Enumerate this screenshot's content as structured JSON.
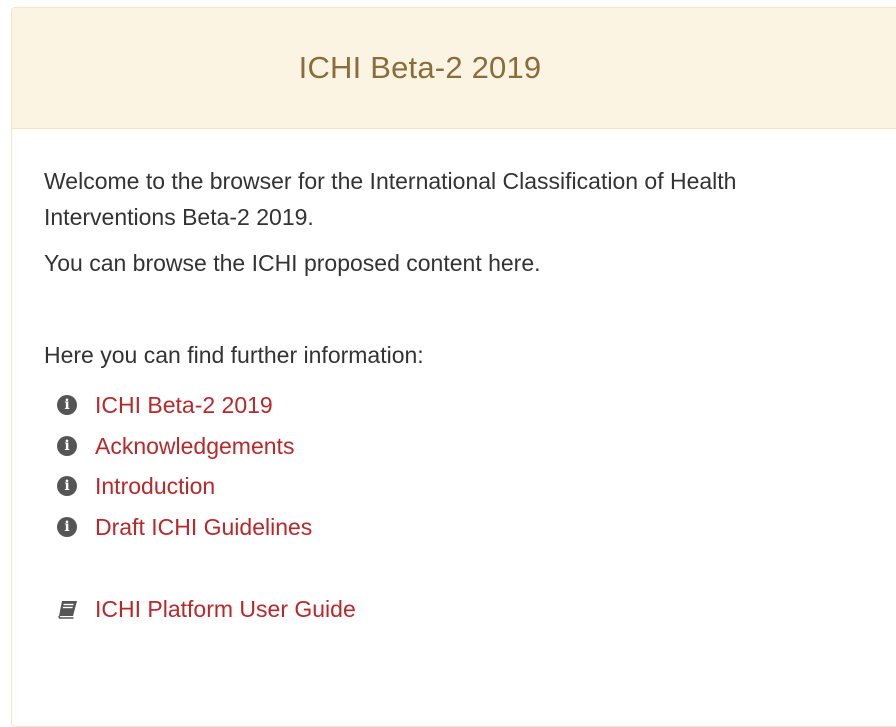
{
  "header": {
    "title": "ICHI Beta-2 2019"
  },
  "intro": {
    "welcome": "Welcome to the browser for the International Classification of Health Interventions Beta-2 2019.",
    "browse": "You can browse the ICHI proposed content here.",
    "further": "Here you can find further information:"
  },
  "links": [
    {
      "label": "ICHI Beta-2 2019",
      "icon": "info-icon"
    },
    {
      "label": "Acknowledgements",
      "icon": "info-icon"
    },
    {
      "label": "Introduction",
      "icon": "info-icon"
    },
    {
      "label": "Draft ICHI Guidelines",
      "icon": "info-icon"
    }
  ],
  "guide": {
    "label": "ICHI Platform User Guide",
    "icon": "book-icon"
  },
  "colors": {
    "header_bg": "#fcf4e2",
    "title": "#8a6d3b",
    "link": "#b8282b",
    "text": "#333333"
  }
}
